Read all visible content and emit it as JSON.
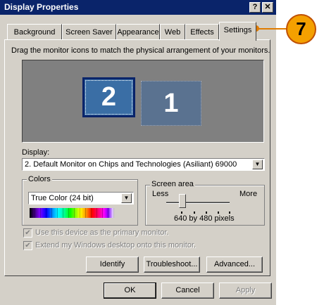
{
  "window": {
    "title": "Display Properties",
    "help_label": "?",
    "close_label": "✕"
  },
  "tabs": [
    {
      "label": "Background"
    },
    {
      "label": "Screen Saver"
    },
    {
      "label": "Appearance"
    },
    {
      "label": "Web"
    },
    {
      "label": "Effects"
    },
    {
      "label": "Settings",
      "active": true
    }
  ],
  "instruction": "Drag the monitor icons to match the physical arrangement of your monitors.",
  "monitors": [
    {
      "number": "2",
      "selected": true
    },
    {
      "number": "1",
      "selected": false
    }
  ],
  "display": {
    "label": "Display:",
    "value": "2. Default Monitor on Chips and Technologies (Asiliant) 69000"
  },
  "colors": {
    "legend": "Colors",
    "value": "True Color (24 bit)"
  },
  "screen_area": {
    "legend": "Screen area",
    "less_label": "Less",
    "more_label": "More",
    "resolution_text": "640 by 480 pixels",
    "slider_level": 0.2
  },
  "checkboxes": [
    {
      "label": "Use this device as the primary monitor.",
      "checked": true,
      "enabled": false
    },
    {
      "label": "Extend my Windows desktop onto this monitor.",
      "checked": true,
      "enabled": false
    }
  ],
  "buttons": {
    "identify": "Identify",
    "troubleshoot": "Troubleshoot...",
    "advanced": "Advanced...",
    "ok": "OK",
    "cancel": "Cancel",
    "apply": "Apply"
  },
  "callout": {
    "number": "7",
    "color": "#f4a000"
  },
  "colors_theme": {
    "titlebar": "#0a246a",
    "face": "#d4d0c8",
    "monitor_selected": "#3a6ea5"
  }
}
